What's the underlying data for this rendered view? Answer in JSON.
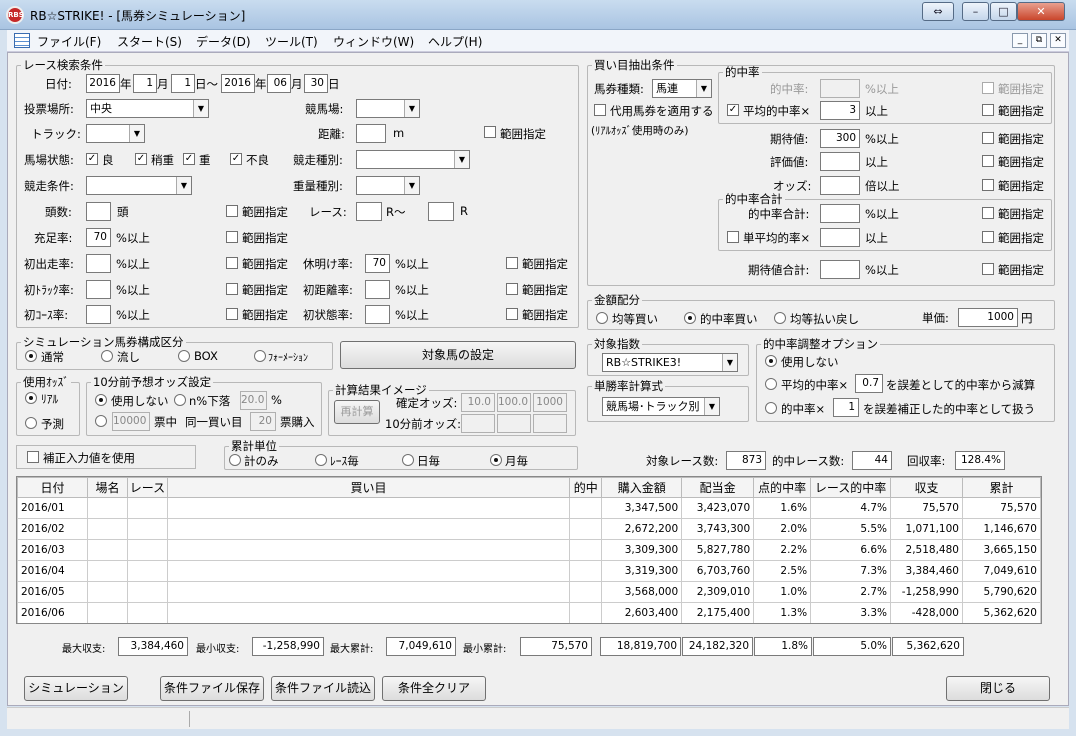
{
  "window": {
    "title": "RB☆STRIKE! - [馬券シミュレーション]",
    "app_icon": "rbs-logo"
  },
  "menu": [
    "ファイル(F)",
    "スタート(S)",
    "データ(D)",
    "ツール(T)",
    "ウィンドウ(W)",
    "ヘルプ(H)"
  ],
  "race": {
    "legend": "レース検索条件",
    "date_label": "日付:",
    "y1": "2016",
    "y_unit": "年",
    "m1": "1",
    "m_unit": "月",
    "d1": "1",
    "d_unit_range": "日～",
    "y2": "2016",
    "m2": "06",
    "d2": "30",
    "d_unit": "日",
    "venue_label": "投票場所:",
    "venue": "中央",
    "course_label": "競馬場:",
    "track_label": "トラック:",
    "dist_label": "距離:",
    "dist_unit": "m",
    "range": "範囲指定",
    "cond_label": "馬場状態:",
    "cond": [
      "良",
      "稍重",
      "重",
      "不良"
    ],
    "type_label": "競走種別:",
    "race_cond_label": "競走条件:",
    "weight_label": "重量種別:",
    "heads_label": "頭数:",
    "heads_unit": "頭",
    "race_no_label": "レース:",
    "race_from": "R～",
    "race_to": "R",
    "fill_label": "充足率:",
    "fill": "70",
    "pct_over": "%以上",
    "first_label": "初出走率:",
    "rest_label": "休明け率:",
    "rest": "70",
    "firsttrack_label": "初ﾄﾗｯｸ率:",
    "firstdist_label": "初距離率:",
    "firstcourse_label": "初ｺｰｽ率:",
    "firststate_label": "初状態率:"
  },
  "sim": {
    "legend": "シミュレーション馬券構成区分",
    "opts": [
      "通常",
      "流し",
      "BOX",
      "ﾌｫｰﾒｰｼｮﾝ"
    ],
    "target_btn": "対象馬の設定"
  },
  "odds": {
    "legend": "使用ｵｯｽﾞ",
    "opts": [
      "ﾘｱﾙ",
      "予測"
    ]
  },
  "pre10": {
    "legend": "10分前予想オッズ設定",
    "unused": "使用しない",
    "drop": "n%下落",
    "drop_val": "20.0",
    "pct": "%",
    "count": "10000",
    "count_unit": "票中",
    "same": "同一買い目",
    "same_val": "20",
    "buy_unit": "票購入"
  },
  "calc": {
    "legend": "計算結果イメージ",
    "btn": "再計算",
    "fixed_label": "確定オッズ:",
    "fixed": [
      "10.0",
      "100.0",
      "1000"
    ],
    "pre_label": "10分前オッズ:"
  },
  "correction": "補正入力値を使用",
  "unit": {
    "legend": "累計単位",
    "opts": [
      "計のみ",
      "ﾚｰｽ毎",
      "日毎",
      "月毎"
    ]
  },
  "buy": {
    "legend": "買い目抽出条件",
    "kind_label": "馬券種類:",
    "kind": "馬連",
    "subst": "代用馬券を適用する",
    "subst_note": "(ﾘｱﾙｵｯｽﾞ使用時のみ)",
    "hit_legend": "的中率",
    "hit_label": "的中率:",
    "pct_over": "%以上",
    "avg_label": "平均的中率×",
    "avg": "3",
    "over": "以上",
    "exp_label": "期待値:",
    "exp": "300",
    "eval_label": "評価値:",
    "odds_label": "オッズ:",
    "odds_unit": "倍以上",
    "sum_legend": "的中率合計",
    "sum_label": "的中率合計:",
    "single_label": "単平均的率×",
    "expsum_label": "期待値合計:",
    "range": "範囲指定"
  },
  "money": {
    "legend": "金額配分",
    "opts": [
      "均等買い",
      "的中率買い",
      "均等払い戻し"
    ],
    "unit_label": "単価:",
    "unit": "1000",
    "yen": "円"
  },
  "index": {
    "legend": "対象指数",
    "value": "RB☆STRIKE3!"
  },
  "win": {
    "legend": "単勝率計算式",
    "value": "競馬場･トラック別"
  },
  "adjust": {
    "legend": "的中率調整オプション",
    "o1": "使用しない",
    "o2a": "平均的中率×",
    "o2v": "0.7",
    "o2b": "を誤差として的中率から減算",
    "o3a": "的中率×",
    "o3v": "1",
    "o3b": "を誤差補正した的中率として扱う"
  },
  "summary": {
    "target_label": "対象レース数:",
    "target": "873",
    "hit_label": "的中レース数:",
    "hit": "44",
    "ret_label": "回収率:",
    "ret": "128.4%"
  },
  "table": {
    "headers": [
      "日付",
      "場名",
      "レース",
      "買い目",
      "的中",
      "購入金額",
      "配当金",
      "点的中率",
      "レース的中率",
      "収支",
      "累計"
    ],
    "rows": [
      [
        "2016/01",
        "",
        "",
        "",
        "",
        "3,347,500",
        "3,423,070",
        "1.6%",
        "4.7%",
        "75,570",
        "75,570"
      ],
      [
        "2016/02",
        "",
        "",
        "",
        "",
        "2,672,200",
        "3,743,300",
        "2.0%",
        "5.5%",
        "1,071,100",
        "1,146,670"
      ],
      [
        "2016/03",
        "",
        "",
        "",
        "",
        "3,309,300",
        "5,827,780",
        "2.2%",
        "6.6%",
        "2,518,480",
        "3,665,150"
      ],
      [
        "2016/04",
        "",
        "",
        "",
        "",
        "3,319,300",
        "6,703,760",
        "2.5%",
        "7.3%",
        "3,384,460",
        "7,049,610"
      ],
      [
        "2016/05",
        "",
        "",
        "",
        "",
        "3,568,000",
        "2,309,010",
        "1.0%",
        "2.7%",
        "-1,258,990",
        "5,790,620"
      ],
      [
        "2016/06",
        "",
        "",
        "",
        "",
        "2,603,400",
        "2,175,400",
        "1.3%",
        "3.3%",
        "-428,000",
        "5,362,620"
      ]
    ]
  },
  "totals": {
    "maxp_label": "最大収支:",
    "maxp": "3,384,460",
    "minp_label": "最小収支:",
    "minp": "-1,258,990",
    "maxc_label": "最大累計:",
    "maxc": "7,049,610",
    "minc_label": "最小累計:",
    "minc": "75,570",
    "buy": "18,819,700",
    "pay": "24,182,320",
    "pt": "1.8%",
    "race": "5.0%",
    "bal": "5,362,620"
  },
  "buttons": {
    "sim": "シミュレーション",
    "save": "条件ファイル保存",
    "load": "条件ファイル読込",
    "clear": "条件全クリア",
    "close": "閉じる"
  }
}
